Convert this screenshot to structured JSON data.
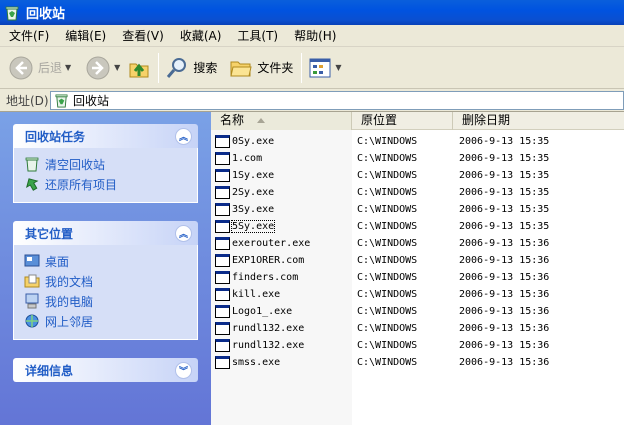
{
  "window": {
    "title": "回收站"
  },
  "menu": [
    "文件(F)",
    "编辑(E)",
    "查看(V)",
    "收藏(A)",
    "工具(T)",
    "帮助(H)"
  ],
  "toolbar": {
    "back": "后退",
    "search": "搜索",
    "folders": "文件夹"
  },
  "address": {
    "label": "地址(D)",
    "value": "回收站"
  },
  "panels": {
    "tasks": {
      "title": "回收站任务",
      "items": [
        "清空回收站",
        "还原所有项目"
      ]
    },
    "places": {
      "title": "其它位置",
      "items": [
        "桌面",
        "我的文档",
        "我的电脑",
        "网上邻居"
      ]
    },
    "details": {
      "title": "详细信息"
    }
  },
  "columns": [
    "名称",
    "原位置",
    "删除日期"
  ],
  "files": [
    {
      "name": "0Sy.exe",
      "location": "C:\\WINDOWS",
      "date": "2006-9-13 15:35"
    },
    {
      "name": "1.com",
      "location": "C:\\WINDOWS",
      "date": "2006-9-13 15:35"
    },
    {
      "name": "1Sy.exe",
      "location": "C:\\WINDOWS",
      "date": "2006-9-13 15:35"
    },
    {
      "name": "2Sy.exe",
      "location": "C:\\WINDOWS",
      "date": "2006-9-13 15:35"
    },
    {
      "name": "3Sy.exe",
      "location": "C:\\WINDOWS",
      "date": "2006-9-13 15:35"
    },
    {
      "name": "5Sy.exe",
      "location": "C:\\WINDOWS",
      "date": "2006-9-13 15:35"
    },
    {
      "name": "exerouter.exe",
      "location": "C:\\WINDOWS",
      "date": "2006-9-13 15:36"
    },
    {
      "name": "EXP1ORER.com",
      "location": "C:\\WINDOWS",
      "date": "2006-9-13 15:36"
    },
    {
      "name": "finders.com",
      "location": "C:\\WINDOWS",
      "date": "2006-9-13 15:36"
    },
    {
      "name": "kill.exe",
      "location": "C:\\WINDOWS",
      "date": "2006-9-13 15:36"
    },
    {
      "name": "Logo1_.exe",
      "location": "C:\\WINDOWS",
      "date": "2006-9-13 15:36"
    },
    {
      "name": "rundl132.exe",
      "location": "C:\\WINDOWS",
      "date": "2006-9-13 15:36"
    },
    {
      "name": "rundl132.exe",
      "location": "C:\\WINDOWS",
      "date": "2006-9-13 15:36"
    },
    {
      "name": "smss.exe",
      "location": "C:\\WINDOWS",
      "date": "2006-9-13 15:36"
    }
  ],
  "icons": {
    "window": "recycle-bin-icon",
    "back": "back-arrow-icon",
    "forward": "forward-arrow-icon",
    "up": "up-folder-icon",
    "search": "search-icon",
    "folders": "folder-icon",
    "views": "views-icon",
    "file": "exe-file-icon"
  },
  "colors": {
    "titlebar": "#0053e0",
    "taskpane": "#6d8ee0",
    "link": "#215dc6"
  }
}
